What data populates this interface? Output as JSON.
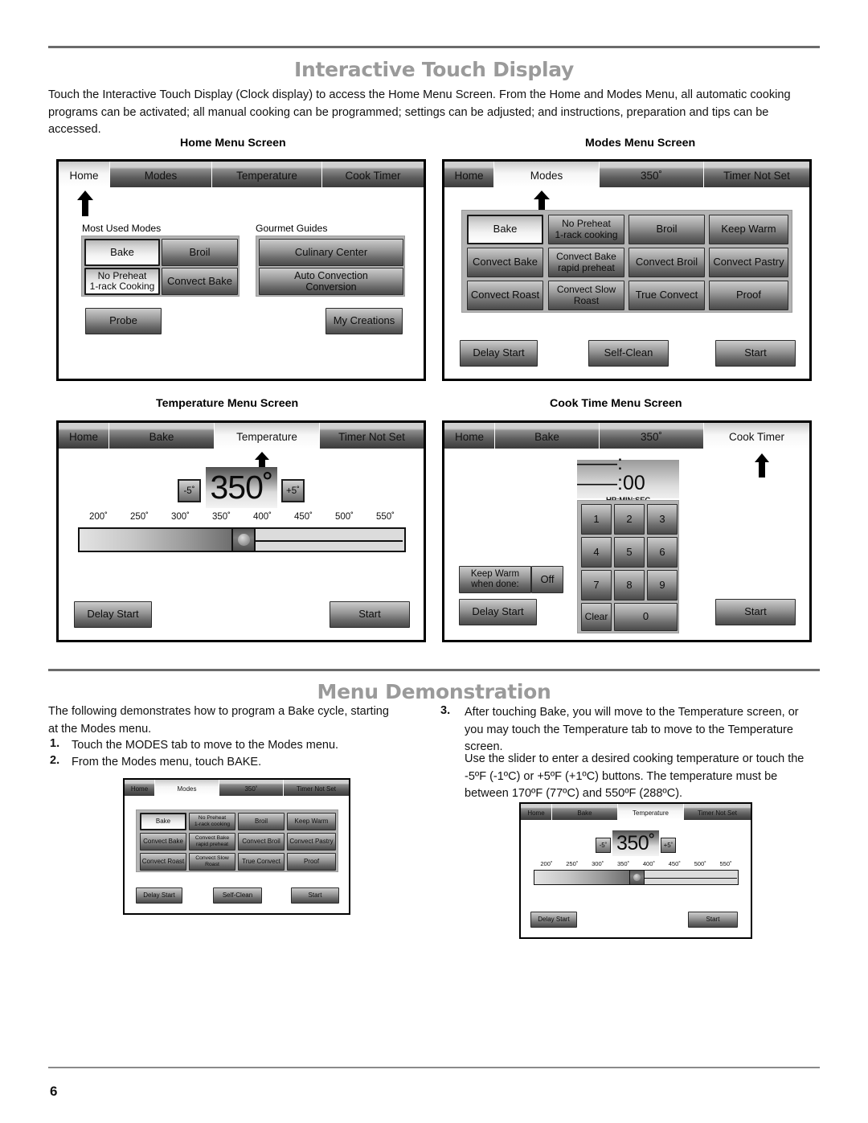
{
  "page": {
    "number": "6",
    "section1_title": "Interactive Touch Display",
    "section2_title": "Menu Demonstration",
    "intro": "Touch the Interactive Touch Display (Clock display) to access the Home Menu Screen. From the Home and Modes Menu, all automatic cooking programs can be activated; all manual cooking can be programmed; settings can be adjusted; and instructions, preparation and tips can be accessed."
  },
  "panels": {
    "home_title": "Home Menu Screen",
    "modes_title": "Modes Menu Screen",
    "temperature_title": "Temperature Menu Screen",
    "cooktime_title": "Cook Time Menu Screen"
  },
  "home_screen": {
    "tabs": [
      {
        "label": "Home",
        "active": true
      },
      {
        "label": "Modes",
        "active": false
      },
      {
        "label": "Temperature",
        "active": false
      },
      {
        "label": "Cook Timer",
        "active": false
      }
    ],
    "group1_caption": "Most Used Modes",
    "group2_caption": "Gourmet Guides",
    "most_used": [
      "Bake",
      "Broil",
      "No Preheat\n1-rack Cooking",
      "Convect Bake"
    ],
    "gourmet": [
      "Culinary Center",
      "Auto Convection\nConversion"
    ],
    "probe": "Probe",
    "my_creations": "My Creations"
  },
  "modes_screen": {
    "tabs": [
      {
        "label": "Home",
        "active": false
      },
      {
        "label": "Modes",
        "active": true
      },
      {
        "label": "350˚",
        "active": false
      },
      {
        "label": "Timer Not Set",
        "active": false
      }
    ],
    "modes": [
      "Bake",
      "No Preheat\n1-rack cooking",
      "Broil",
      "Keep Warm",
      "Convect Bake",
      "Convect Bake\nrapid preheat",
      "Convect Broil",
      "Convect Pastry",
      "Convect Roast",
      "Convect Slow\nRoast",
      "True Convect",
      "Proof"
    ],
    "selected_mode": "Bake",
    "delay_start": "Delay Start",
    "self_clean": "Self-Clean",
    "start": "Start"
  },
  "temperature_screen": {
    "tabs": [
      {
        "label": "Home",
        "active": false
      },
      {
        "label": "Bake",
        "active": false
      },
      {
        "label": "Temperature",
        "active": true
      },
      {
        "label": "Timer Not Set",
        "active": false
      }
    ],
    "minus": "-5˚",
    "plus": "+5˚",
    "value": "350˚",
    "ticks": [
      "200˚",
      "250˚",
      "300˚",
      "350˚",
      "400˚",
      "450˚",
      "500˚",
      "550˚"
    ],
    "delay_start": "Delay Start",
    "start": "Start"
  },
  "cooktime_screen": {
    "tabs": [
      {
        "label": "Home",
        "active": false
      },
      {
        "label": "Bake",
        "active": false
      },
      {
        "label": "350˚",
        "active": false
      },
      {
        "label": "Cook Timer",
        "active": true
      }
    ],
    "display_value": "——:——:00",
    "display_label": "HR:MIN:SEC",
    "keys": [
      "1",
      "2",
      "3",
      "4",
      "5",
      "6",
      "7",
      "8",
      "9",
      "Clear",
      "0"
    ],
    "keep_warm_label": "Keep Warm\nwhen done:",
    "keep_warm_value": "Off",
    "delay_start": "Delay Start",
    "start": "Start"
  },
  "demo": {
    "lead": "The following demonstrates how to program a Bake cycle, starting at the Modes menu.",
    "step1_num": "1.",
    "step1": "Touch the MODES tab to move to the Modes menu.",
    "step2_num": "2.",
    "step2": "From the Modes menu, touch BAKE.",
    "step3_num": "3.",
    "step3": "After touching Bake, you will move to the Temperature screen, or you may touch the Temperature tab to move to the Temperature screen.",
    "step3b": "Use the slider to enter a desired cooking temperature or touch the -5ºF (-1ºC) or +5ºF (+1ºC) buttons. The temperature must be between 170ºF (77ºC) and 550ºF (288ºC)."
  },
  "colors": {
    "rule": "#6b6b6b",
    "title": "#9a9a9a",
    "screen_border": "#000000",
    "well": "#b4b4b4"
  }
}
